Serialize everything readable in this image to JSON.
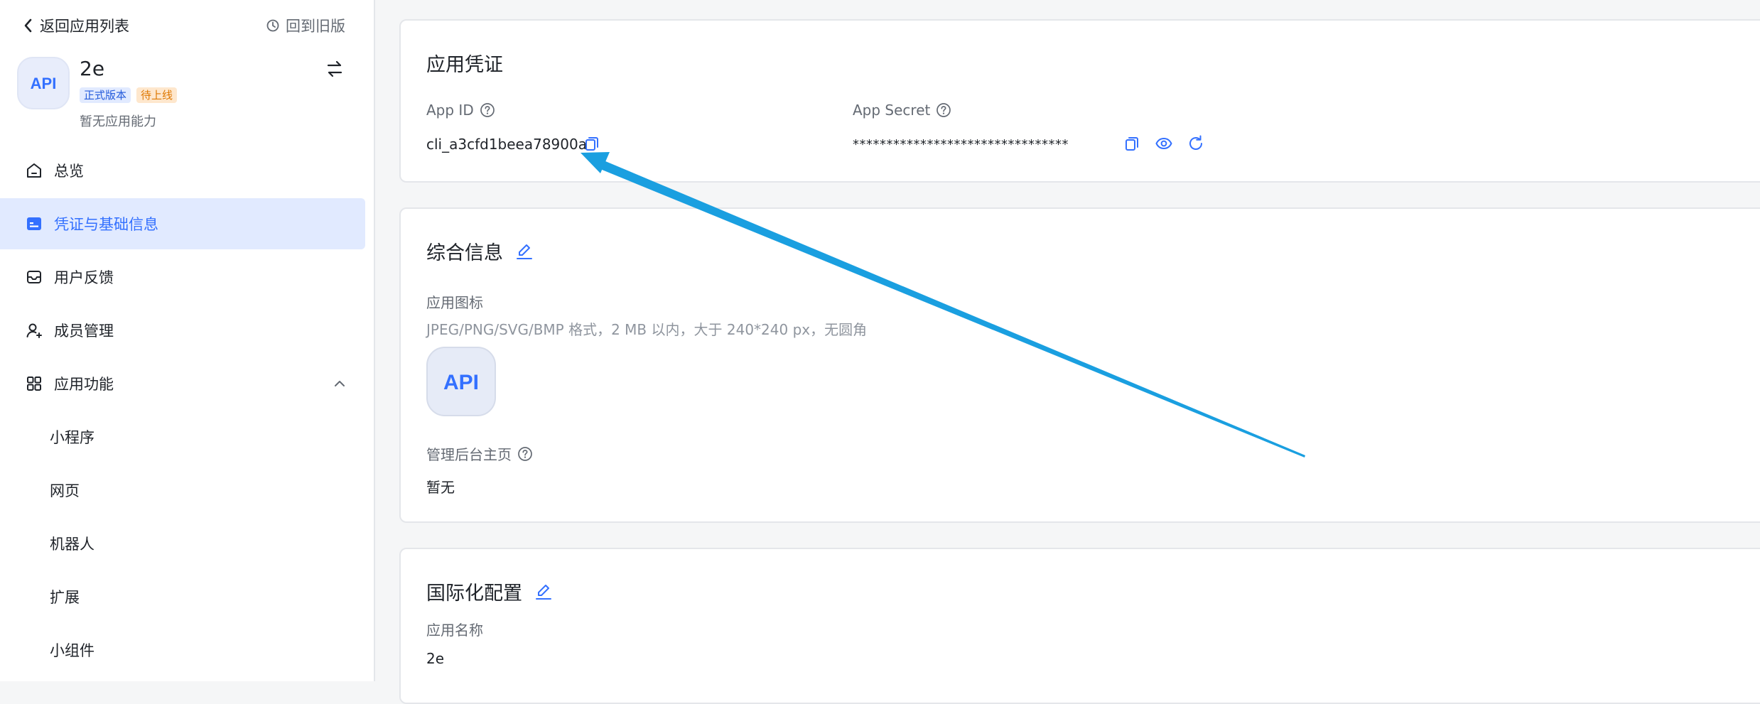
{
  "sidebar": {
    "back_label": "返回应用列表",
    "old_version_label": "回到旧版",
    "app": {
      "name": "2e",
      "logo_text": "API",
      "badge_formal": "正式版本",
      "badge_pending": "待上线",
      "capability": "暂无应用能力"
    },
    "nav": {
      "overview": "总览",
      "credentials": "凭证与基础信息",
      "feedback": "用户反馈",
      "members": "成员管理",
      "features": "应用功能",
      "miniprogram": "小程序",
      "webpage": "网页",
      "bot": "机器人",
      "extension": "扩展",
      "widget": "小组件"
    }
  },
  "credentials": {
    "title": "应用凭证",
    "app_id_label": "App ID",
    "app_id_value": "cli_a3cfd1beea78900a",
    "app_secret_label": "App Secret",
    "app_secret_value": "********************************"
  },
  "general": {
    "title": "综合信息",
    "icon_label": "应用图标",
    "icon_hint": "JPEG/PNG/SVG/BMP 格式，2 MB 以内，大于 240*240 px，无圆角",
    "logo_text": "API",
    "admin_home_label": "管理后台主页",
    "admin_home_value": "暂无"
  },
  "i18n": {
    "title": "国际化配置",
    "app_name_label": "应用名称",
    "app_name_value": "2e"
  },
  "colors": {
    "accent": "#3370ff",
    "annotation_arrow": "#1a9fe0"
  }
}
